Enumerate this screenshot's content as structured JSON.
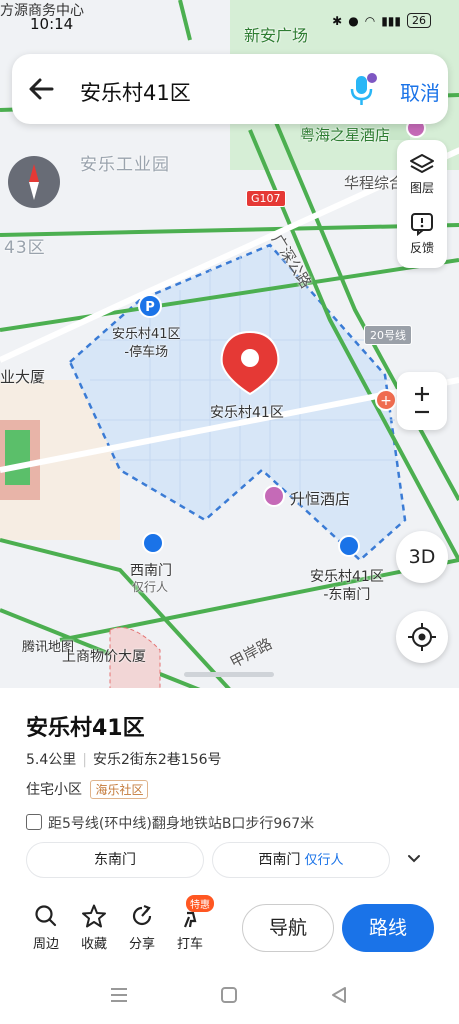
{
  "status": {
    "time": "10:14",
    "top_left_text": "方源商务中心",
    "battery": "26"
  },
  "search": {
    "query": "安乐村41区",
    "cancel_label": "取消"
  },
  "map": {
    "labels": {
      "industrial_park": "安乐工业园",
      "area43": "43区",
      "hotel_yuehai": "粤海之星酒店",
      "huacheng": "华程综合",
      "xinan_plaza": "新安广场",
      "road_guangshen": "广深公路",
      "road_g107": "G107",
      "line20": "20号线",
      "parking": "安乐村41区\n-停车场",
      "poi_main": "安乐村41区",
      "hotel_shengheng": "升恒酒店",
      "west_gate": "西南门",
      "west_gate_sub": "仅行人",
      "east_gate": "安乐村41区\n-东南门",
      "industry_building": "业大厦",
      "tencent": "腾讯地图",
      "shangwu": "上商物价大厦",
      "road_jiaan": "甲岸路"
    },
    "controls": {
      "layers_label": "图层",
      "feedback_label": "反馈",
      "btn_3d": "3D"
    }
  },
  "place": {
    "name": "安乐村41区",
    "distance": "5.4公里",
    "address": "安乐2街东2巷156号",
    "type": "住宅小区",
    "community": "海乐社区",
    "metro": "距5号线(环中线)翻身地铁站B口步行967米",
    "gates": [
      {
        "label": "东南门",
        "hint": ""
      },
      {
        "label": "西南门",
        "hint": "仅行人"
      }
    ]
  },
  "actions": {
    "nearby": "周边",
    "favorite": "收藏",
    "share": "分享",
    "taxi": "打车",
    "taxi_badge": "特惠",
    "navigate": "导航",
    "route": "路线"
  },
  "colors": {
    "accent": "#1a73e8",
    "marker": "#e53935",
    "area_fill": "#dbe8f8",
    "road_green": "#4caf50"
  }
}
